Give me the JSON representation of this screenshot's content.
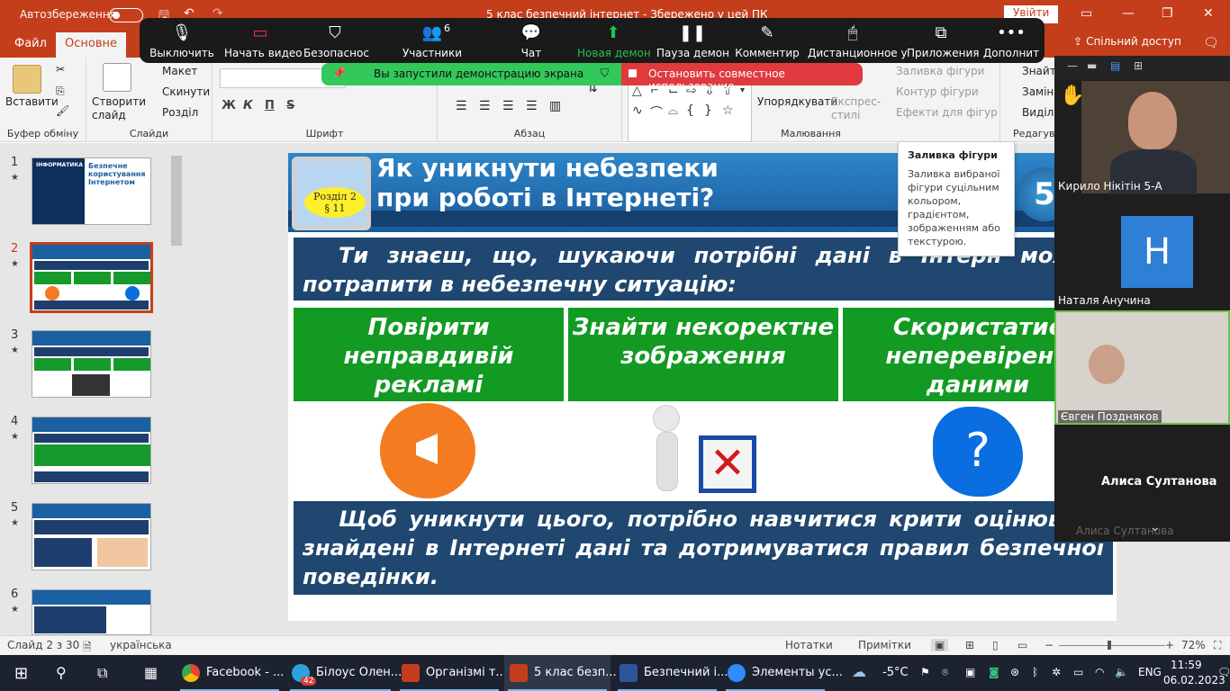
{
  "window": {
    "autosave": "Автозбереження",
    "title": "5 клас безпечний інтернет  -  Збережено у цей ПК",
    "signin": "Увійти"
  },
  "tabs": [
    "Файл",
    "Основне"
  ],
  "share": "Спільний доступ",
  "ribbon": {
    "clipboard": {
      "paste": "Вставити",
      "label": "Буфер обміну"
    },
    "slides": {
      "new_slide": "Створити слайд",
      "layout": "Макет",
      "reset": "Скинути",
      "section": "Розділ",
      "label": "Слайди"
    },
    "font": {
      "label": "Шрифт",
      "bold": "Ж",
      "italic": "К",
      "underline": "П",
      "strike": "S"
    },
    "paragraph": {
      "label": "Абзац"
    },
    "drawing": {
      "arrange": "Упорядкувати",
      "quick_styles": "Експрес-стилі",
      "fill": "Заливка фігури",
      "outline": "Контур фігури",
      "effects": "Ефекти для фігур",
      "label": "Малювання"
    },
    "editing": {
      "find": "Знайти",
      "replace": "Заміни",
      "select": "Виділі",
      "label": "Редагува"
    }
  },
  "zoom_toolbar": {
    "items": [
      {
        "label": "Выключить",
        "icon": "microphone-icon"
      },
      {
        "label": "Начать видео",
        "icon": "video-off-icon"
      },
      {
        "label": "Безопаснос",
        "icon": "shield-icon"
      },
      {
        "label": "Участники",
        "icon": "participants-icon",
        "count": "6"
      },
      {
        "label": "Чат",
        "icon": "chat-icon"
      },
      {
        "label": "Новая демон",
        "icon": "share-screen-icon"
      },
      {
        "label": "Пауза демон",
        "icon": "pause-icon"
      },
      {
        "label": "Комментир",
        "icon": "pen-icon"
      },
      {
        "label": "Дистанционное у",
        "icon": "mouse-icon"
      },
      {
        "label": "Приложения",
        "icon": "apps-icon"
      },
      {
        "label": "Дополнит",
        "icon": "more-icon"
      }
    ],
    "sharing_notice": "Вы запустили демонстрацию экрана",
    "stop_share": "Остановить совместное использование"
  },
  "slide_panel": {
    "numbers": [
      "1",
      "2",
      "3",
      "4",
      "5",
      "6"
    ],
    "selected_index": 2,
    "thumb1_title": "Безпечне користування Інтернетом",
    "thumb1_brand": "ІНФОРМАТИКА"
  },
  "slide": {
    "section_line1": "Розділ 2",
    "section_line2": "§ 11",
    "title_line1": "Як уникнути небезпеки",
    "title_line2": "при роботі в Інтернеті?",
    "badge": "5",
    "intro": "Ти знаєш, що, шукаючи потрібні дані в Інтерн можна потрапити в небезпечну ситуацію:",
    "boxes": [
      "Повірити неправдивій рекламі",
      "Знайти некоректне зображення",
      "Скористатис неперевірени даними"
    ],
    "question": "?",
    "xmark": "✕",
    "outro": "Щоб уникнути цього, потрібно навчитися крити оцінювати знайдені в Інтернеті дані та дотримуватися правил безпечної поведінки."
  },
  "tooltip": {
    "title": "Заливка фігури",
    "body": "Заливка вибраної фігури суцільним кольором, градієнтом, зображенням або текстурою."
  },
  "participants": [
    {
      "name": "Кирило Нікітін 5-А"
    },
    {
      "name": "Наталя Анучина",
      "initial": "H"
    },
    {
      "name": "Євген Поздняков"
    },
    {
      "name": "Алиса Султанова"
    },
    {
      "name": "Алиса Султанова"
    }
  ],
  "statusbar": {
    "slide": "Слайд 2 з 30",
    "language": "українська",
    "notes": "Нотатки",
    "comments": "Примітки",
    "zoom": "72%"
  },
  "taskbar": {
    "apps": [
      {
        "label": "Facebook - ...",
        "icon": "chrome-icon"
      },
      {
        "label": "Білоус Олен...",
        "icon": "telegram-icon",
        "badge": "42"
      },
      {
        "label": "Організмі т...",
        "icon": "powerpoint-icon"
      },
      {
        "label": "5 клас безп...",
        "icon": "powerpoint-icon"
      },
      {
        "label": "Безпечний і...",
        "icon": "word-icon"
      },
      {
        "label": "Элементы ус...",
        "icon": "zoom-icon"
      }
    ],
    "weather": "-5°C",
    "language": "ENG",
    "time": "11:59",
    "date": "06.02.2023"
  },
  "colors": {
    "accent": "#c43e1c",
    "zoom_bg": "#1a1a1a",
    "slide_green": "#129a23",
    "slide_navy": "#1f4770"
  }
}
